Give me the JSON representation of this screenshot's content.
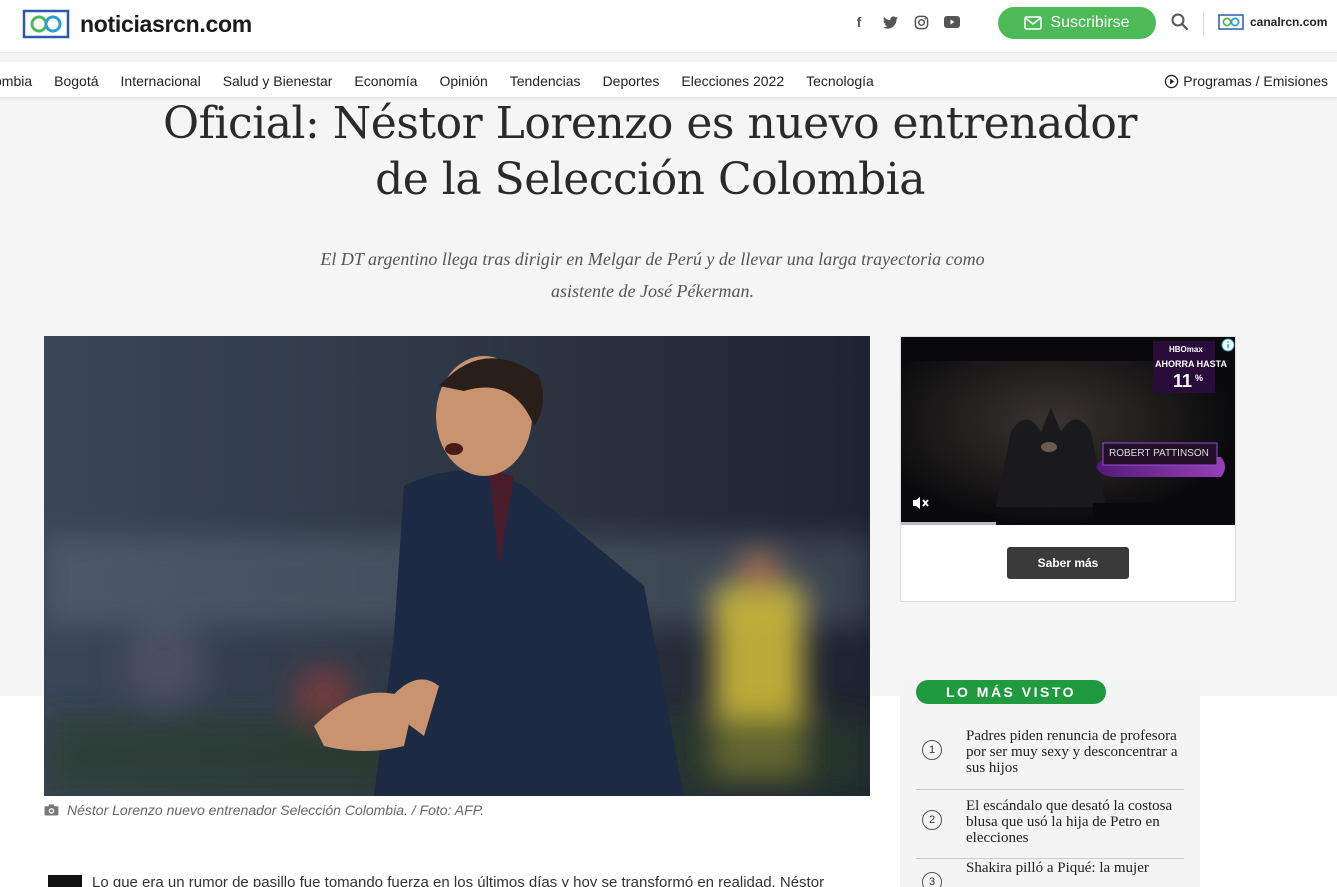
{
  "header": {
    "logo_text": "noticiasrcn.com",
    "subscribe_label": "Suscribirse",
    "partner_logo_text": "canalrcn.com",
    "social_icons": [
      "facebook-icon",
      "twitter-icon",
      "instagram-icon",
      "youtube-icon"
    ],
    "brand_color": "#4cba56"
  },
  "nav": {
    "items": [
      "ombia",
      "Bogotá",
      "Internacional",
      "Salud y Bienestar",
      "Economía",
      "Opinión",
      "Tendencias",
      "Deportes",
      "Elecciones 2022",
      "Tecnología"
    ],
    "programs_label": "Programas / Emisiones"
  },
  "article": {
    "title": "Oficial: Néstor Lorenzo es nuevo entrenador de la Selección Colombia",
    "subtitle": "El DT argentino llega tras dirigir en Melgar de Perú y de llevar una larga trayectoria como asistente de José Pékerman.",
    "caption": "Néstor Lorenzo nuevo entrenador Selección Colombia. / Foto: AFP.",
    "body_start": "Lo que era un rumor de pasillo fue tomando fuerza en los últimos días y hoy se transformó en realidad. Néstor"
  },
  "ad": {
    "brand": "HBOmax",
    "promo_label": "AHORRA HASTA",
    "promo_value": "11",
    "promo_unit": "%",
    "actor_label": "ROBERT PATTINSON",
    "cta_label": "Saber más"
  },
  "most_viewed": {
    "heading": "LO MÁS VISTO",
    "items": [
      {
        "num": "1",
        "text": "Padres piden renuncia de profesora por ser muy sexy y desconcentrar a sus hijos"
      },
      {
        "num": "2",
        "text": "El escándalo que desató la costosa blusa que usó la hija de Petro en elecciones"
      },
      {
        "num": "3",
        "text": "Shakira pilló a Piqué: la mujer"
      }
    ],
    "accent_color": "#1f9a3e"
  }
}
